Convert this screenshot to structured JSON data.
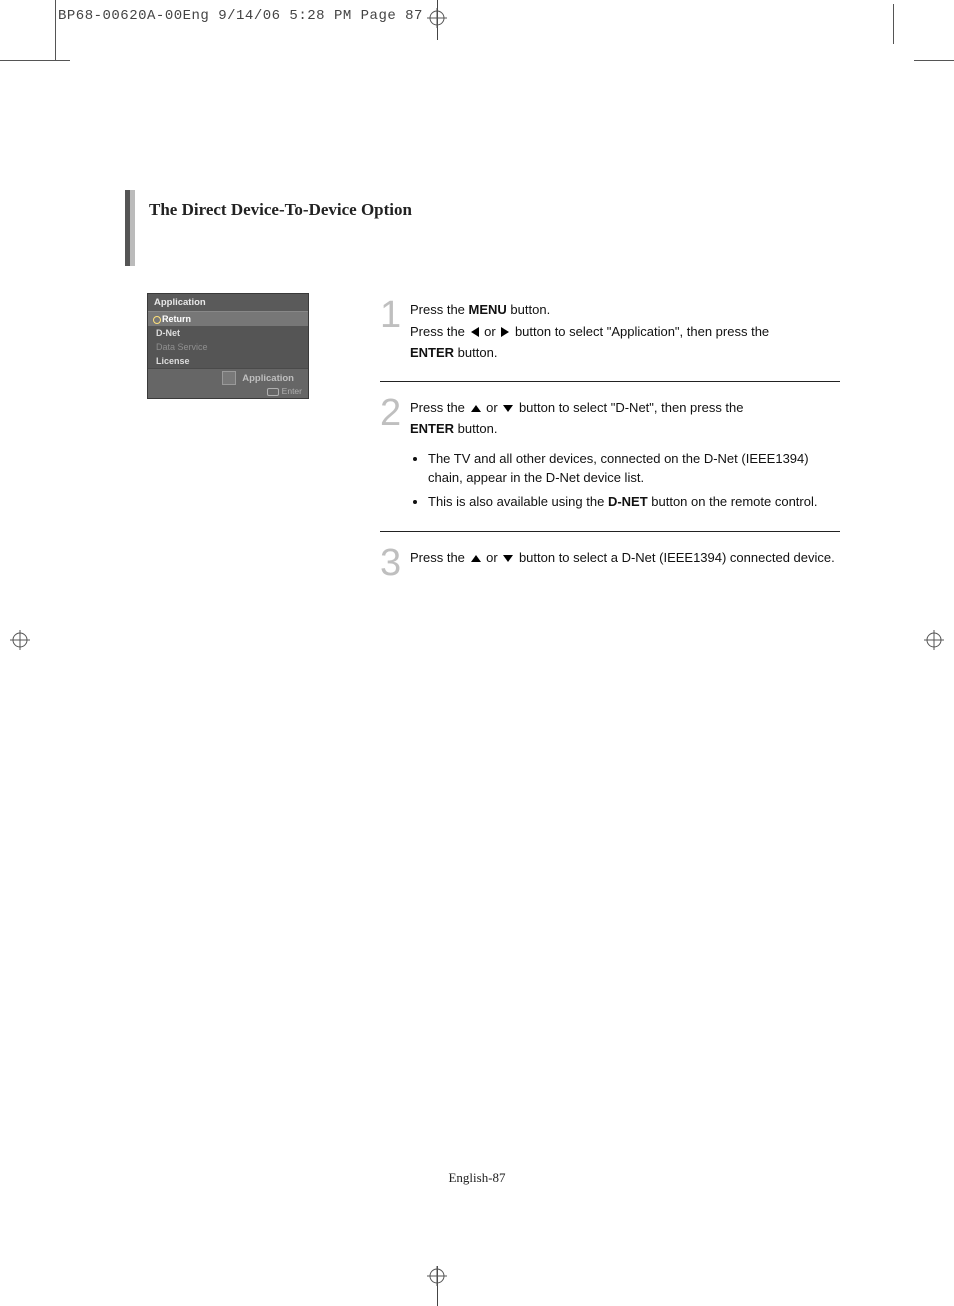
{
  "print_header": "BP68-00620A-00Eng  9/14/06  5:28 PM  Page 87",
  "section_title": "The Direct Device-To-Device Option",
  "osd": {
    "title": "Application",
    "return": "Return",
    "items": [
      "D-Net",
      "Data Service",
      "License"
    ],
    "footer_label": "Application",
    "enter_label": "Enter"
  },
  "steps": {
    "s1": {
      "num": "1",
      "l1a": "Press the ",
      "l1b": "MENU",
      "l1c": " button.",
      "l2a": "Press the ",
      "l2b": " or ",
      "l2c": " button to select \"Application\", then press the ",
      "l3a": "ENTER",
      "l3b": " button."
    },
    "s2": {
      "num": "2",
      "l1a": "Press the ",
      "l1b": " or ",
      "l1c": " button to select \"D-Net\", then press the ",
      "l2a": "ENTER",
      "l2b": " button.",
      "b1": "The TV and all other devices, connected on the D-Net (IEEE1394) chain, appear in the D-Net device list.",
      "b2a": "This is also available using the ",
      "b2b": "D-NET",
      "b2c": " button on the remote control."
    },
    "s3": {
      "num": "3",
      "l1a": "Press the ",
      "l1b": " or ",
      "l1c": " button to select a D-Net (IEEE1394) connected device."
    }
  },
  "footer": "English-87"
}
